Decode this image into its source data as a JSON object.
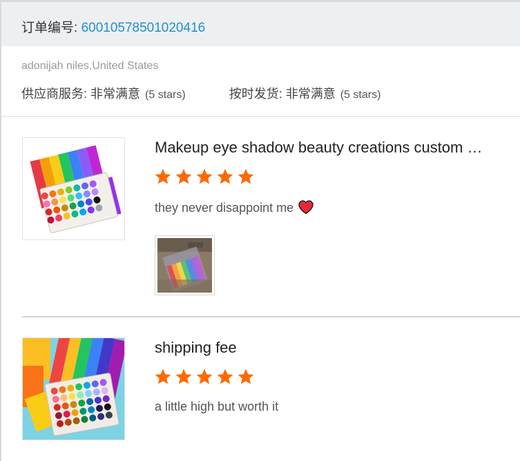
{
  "order": {
    "label": "订单编号: ",
    "number": "60010578501020416"
  },
  "buyer": {
    "name_country": "adonijah niles,United States"
  },
  "seller_ratings": [
    {
      "label": "供应商服务: ",
      "value": "非常满意",
      "stars_text": "(5 stars)"
    },
    {
      "label": "按时发货: ",
      "value": "非常满意",
      "stars_text": "(5 stars)"
    }
  ],
  "reviews": [
    {
      "product_title": "Makeup eye shadow beauty creations custom …",
      "rating": 5,
      "comment": "they never disappoint me",
      "has_photo": true,
      "emoji_icon": "heart-icon"
    },
    {
      "product_title": "shipping fee",
      "rating": 5,
      "comment": "a little high but worth it",
      "has_photo": false
    }
  ],
  "colors": {
    "order_number": "#1f8fd6",
    "star": "#ff6a00",
    "header_bg": "#eeeff1",
    "heart": "#e8283a"
  }
}
